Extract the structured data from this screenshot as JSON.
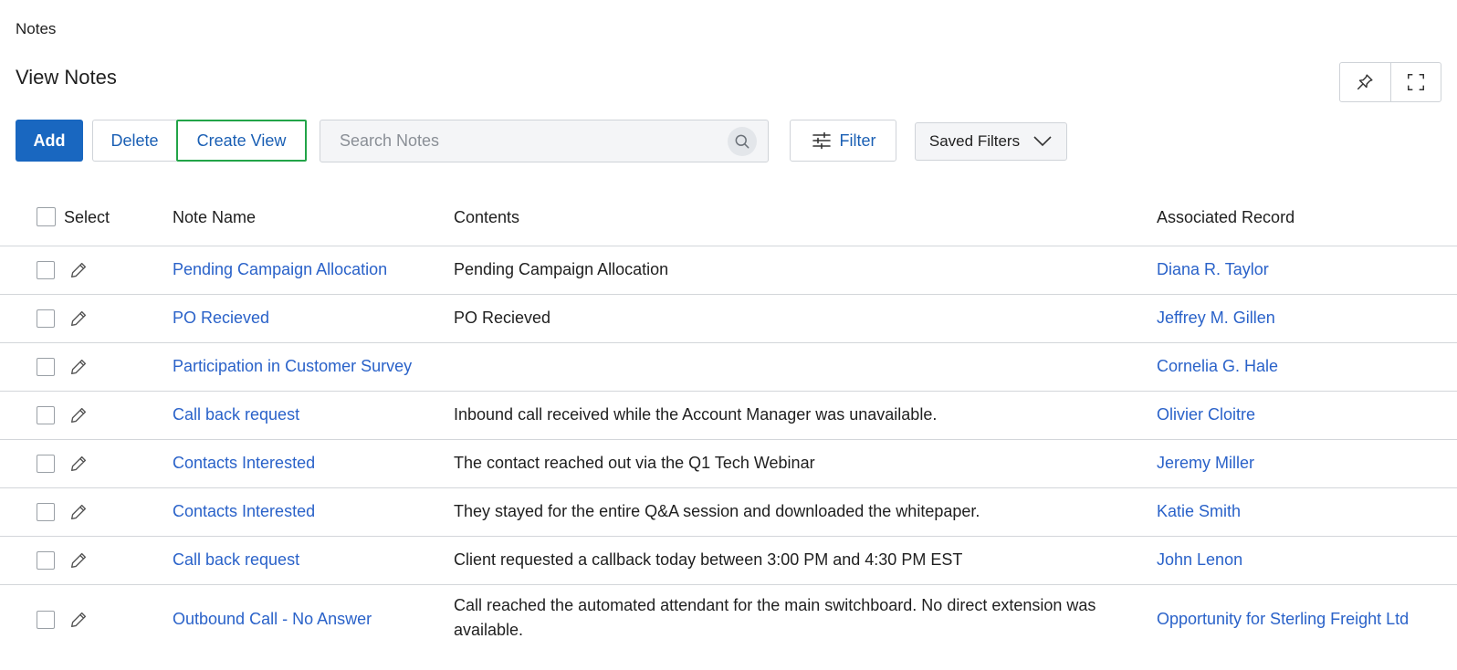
{
  "breadcrumb": "Notes",
  "page_title": "View Notes",
  "toolbar": {
    "add_label": "Add",
    "delete_label": "Delete",
    "create_view_label": "Create View",
    "search_placeholder": "Search Notes",
    "filter_label": "Filter",
    "saved_filters_label": "Saved Filters"
  },
  "columns": {
    "select": "Select",
    "note_name": "Note Name",
    "contents": "Contents",
    "associated_record": "Associated Record"
  },
  "rows": [
    {
      "name": "Pending Campaign Allocation",
      "contents": "Pending Campaign Allocation",
      "record": "Diana R. Taylor"
    },
    {
      "name": "PO Recieved",
      "contents": "PO Recieved",
      "record": "Jeffrey M. Gillen"
    },
    {
      "name": "Participation in Customer Survey",
      "contents": "",
      "record": "Cornelia G. Hale"
    },
    {
      "name": "Call back request",
      "contents": "Inbound call received while the Account Manager was unavailable.",
      "record": "Olivier Cloitre"
    },
    {
      "name": "Contacts Interested",
      "contents": "The contact reached out via the Q1 Tech Webinar",
      "record": "Jeremy Miller"
    },
    {
      "name": "Contacts Interested",
      "contents": "They stayed for the entire Q&A session and downloaded the whitepaper.",
      "record": "Katie Smith"
    },
    {
      "name": "Call back request",
      "contents": "Client requested a callback today between 3:00 PM and 4:30 PM EST",
      "record": "John Lenon"
    },
    {
      "name": "Outbound Call - No Answer",
      "contents": "Call reached the automated attendant for the main switchboard. No direct extension was available.",
      "record": "Opportunity for Sterling Freight Ltd"
    }
  ],
  "colors": {
    "primary": "#1967c0",
    "link": "#2a62c9",
    "highlight_border": "#22a448"
  },
  "icons": [
    "pin-icon",
    "fullscreen-icon",
    "search-icon",
    "filter-sliders-icon",
    "chevron-down-icon",
    "pencil-icon"
  ]
}
